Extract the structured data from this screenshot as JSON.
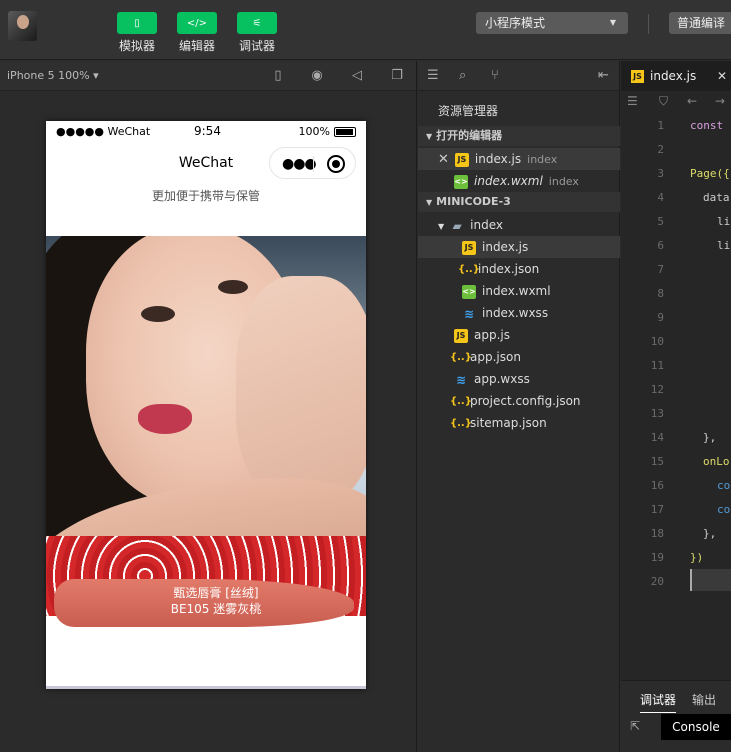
{
  "toolbar": {
    "simulator_label": "模拟器",
    "editor_label": "编辑器",
    "debugger_label": "调试器",
    "mode_select": "小程序模式",
    "compile_label": "普通编译"
  },
  "simulator": {
    "device": "iPhone 5 100% ▾",
    "status": {
      "carrier": "●●●●● WeChat",
      "time": "9:54",
      "battery": "100%"
    },
    "nav_title": "WeChat",
    "capsule_dots": "●●●",
    "subtitle": "更加便于携带与保管",
    "product_line1": "甄选唇膏 [丝绒]",
    "product_line2": "BE105 迷雾灰桃"
  },
  "explorer": {
    "title": "资源管理器",
    "open_editors_section": "打开的编辑器",
    "project_section": "MINICODE-3",
    "open_editors": [
      {
        "name": "index.js",
        "hint": "index"
      },
      {
        "name": "index.wxml",
        "hint": "index"
      }
    ],
    "tree": {
      "folder": "index",
      "folder_files": [
        "index.js",
        "index.json",
        "index.wxml",
        "index.wxss"
      ],
      "root_files": [
        "app.js",
        "app.json",
        "app.wxss",
        "project.config.json",
        "sitemap.json"
      ]
    }
  },
  "editor": {
    "tab_name": "index.js",
    "line_numbers": [
      "1",
      "2",
      "3",
      "4",
      "5",
      "6",
      "7",
      "8",
      "9",
      "10",
      "11",
      "12",
      "13",
      "14",
      "15",
      "16",
      "17",
      "18",
      "19",
      "20"
    ],
    "code": {
      "l1": "const",
      "l3": "Page({",
      "l4": "data",
      "l5": "li",
      "l6": "li",
      "l14": "},",
      "l15": "onLo",
      "l16": "co",
      "l17": "co",
      "l18": "},",
      "l19": "})"
    },
    "debug_tabs": {
      "debugger": "调试器",
      "output": "输出"
    },
    "console_label": "Console"
  },
  "colors": {
    "accent_green": "#07c160",
    "js_icon": "#f5c518",
    "wxml_icon": "#6bbf3b",
    "wxss_icon": "#3ea3f2"
  }
}
